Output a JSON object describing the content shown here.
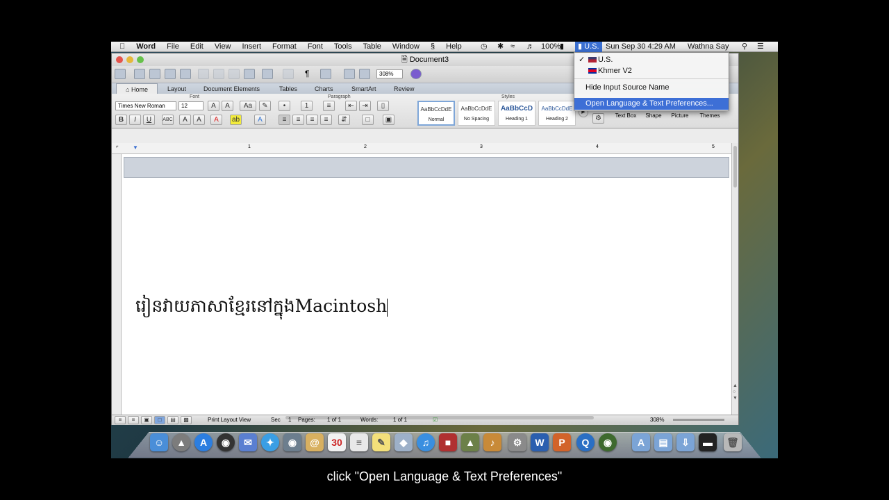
{
  "menubar": {
    "apple": "",
    "items": [
      "Word",
      "File",
      "Edit",
      "View",
      "Insert",
      "Format",
      "Font",
      "Tools",
      "Table",
      "Window",
      "Help"
    ],
    "battery": "100%",
    "input_source": "U.S.",
    "datetime": "Sun Sep 30  4:29 AM",
    "user": "Wathna Say"
  },
  "window": {
    "title": "Document3",
    "zoom": "308%",
    "tabs": [
      "Home",
      "Layout",
      "Document Elements",
      "Tables",
      "Charts",
      "SmartArt",
      "Review"
    ],
    "groups": {
      "font": "Font",
      "paragraph": "Paragraph",
      "styles": "Styles"
    },
    "font_name": "Times New Roman",
    "font_size": "12",
    "styles": [
      {
        "preview": "AaBbCcDdE",
        "name": "Normal"
      },
      {
        "preview": "AaBbCcDdE",
        "name": "No Spacing"
      },
      {
        "preview": "AaBbCcD",
        "name": "Heading 1"
      },
      {
        "preview": "AaBbCcDdE",
        "name": "Heading 2"
      }
    ],
    "insert_items": [
      "Text Box",
      "Shape",
      "Picture",
      "Themes"
    ],
    "ruler_numbers": [
      "1",
      "2",
      "3",
      "4",
      "5"
    ],
    "document_khmer": "រៀនវាយភាសាខ្មែរនៅក្នុង",
    "document_latin": "Macintosh",
    "status": {
      "view": "Print Layout View",
      "sec_label": "Sec",
      "sec": "1",
      "pages_label": "Pages:",
      "pages": "1 of 1",
      "words_label": "Words:",
      "words": "1 of 1",
      "zoom": "308%"
    }
  },
  "dropdown": {
    "items": [
      {
        "label": "U.S.",
        "checked": true
      },
      {
        "label": "Khmer V2",
        "checked": false
      }
    ],
    "hide": "Hide Input Source Name",
    "open_prefs": "Open Language & Text Preferences..."
  },
  "caption": "click \"Open Language & Text Preferences\"",
  "colors": {
    "highlight": "#3d6fd6",
    "menubar": "#e6e6e6"
  }
}
